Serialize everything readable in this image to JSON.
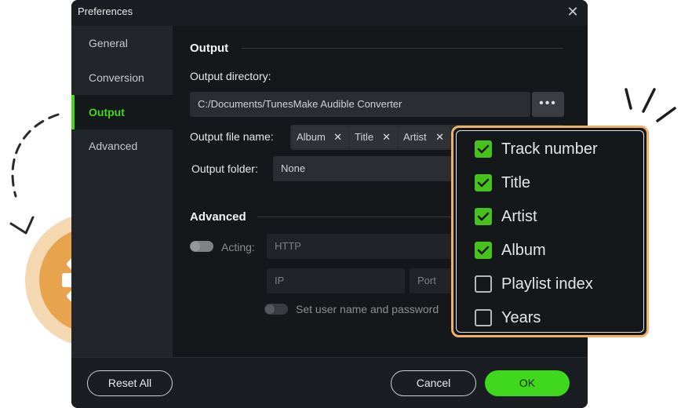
{
  "window": {
    "title": "Preferences",
    "close_glyph": "✕"
  },
  "sidebar": {
    "items": [
      {
        "label": "General",
        "active": false
      },
      {
        "label": "Conversion",
        "active": false
      },
      {
        "label": "Output",
        "active": true
      },
      {
        "label": "Advanced",
        "active": false
      }
    ]
  },
  "output": {
    "section_title": "Output",
    "directory_label": "Output directory:",
    "directory_value": "C:/Documents/TunesMake Audible Converter",
    "browse_glyph": "•••",
    "filename_label": "Output file name:",
    "filename_tags": [
      {
        "label": "Album",
        "remove": "✕"
      },
      {
        "label": "Title",
        "remove": "✕"
      },
      {
        "label": "Artist",
        "remove": "✕"
      }
    ],
    "folder_label": "Output folder:",
    "folder_value": "None"
  },
  "advanced": {
    "section_title": "Advanced",
    "acting_label": "Acting:",
    "acting_value": "HTTP",
    "ip_placeholder": "IP",
    "port_placeholder": "Port",
    "auth_label": "Set user name and password"
  },
  "footer": {
    "reset_label": "Reset All",
    "cancel_label": "Cancel",
    "ok_label": "OK"
  },
  "popup": {
    "options": [
      {
        "label": "Track number",
        "checked": true
      },
      {
        "label": "Title",
        "checked": true
      },
      {
        "label": "Artist",
        "checked": true
      },
      {
        "label": "Album",
        "checked": true
      },
      {
        "label": "Playlist index",
        "checked": false
      },
      {
        "label": "Years",
        "checked": false
      }
    ]
  },
  "colors": {
    "accent_green": "#3fd81c",
    "orange": "#e8a34e",
    "window_bg": "#15181b"
  },
  "icons": {
    "gear": "gear-icon",
    "close": "close-icon",
    "more": "more-dots-icon",
    "checkmark": "checkmark-icon"
  }
}
